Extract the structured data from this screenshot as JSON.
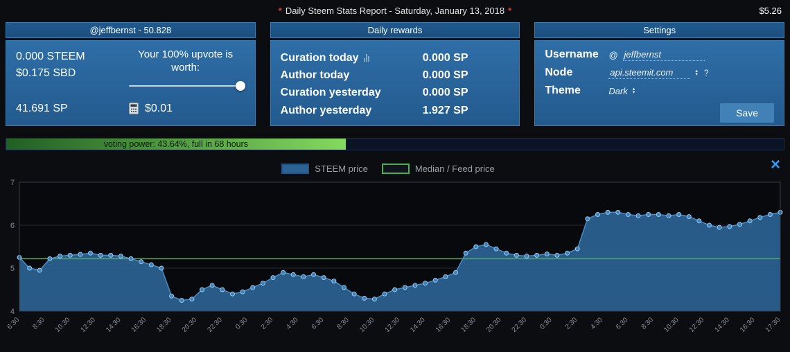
{
  "colors": {
    "accent_red": "#e03b3b",
    "panel_blue": "#2e6ea7",
    "close_blue": "#2f9bf0",
    "voting_green": "#84d95f"
  },
  "topbar": {
    "star": "*",
    "title": "Daily Steem Stats Report - Saturday, January 13, 2018",
    "price": "$5.26"
  },
  "account_panel": {
    "header": "@jeffbernst - 50.828",
    "steem_balance": "0.000 STEEM",
    "sbd_balance": "$0.175 SBD",
    "upvote_label": "Your 100% upvote is worth:",
    "slider_percent": 100,
    "sp_balance": "41.691 SP",
    "upvote_value": "$0.01"
  },
  "rewards_panel": {
    "header": "Daily rewards",
    "rows": [
      {
        "label": "Curation today",
        "value": "0.000 SP"
      },
      {
        "label": "Author today",
        "value": "0.000 SP"
      },
      {
        "label": "Curation yesterday",
        "value": "0.000 SP"
      },
      {
        "label": "Author yesterday",
        "value": "1.927 SP"
      }
    ]
  },
  "settings_panel": {
    "header": "Settings",
    "username_label": "Username",
    "username_prefix": "@",
    "username_value": "jeffbernst",
    "node_label": "Node",
    "node_value": "api.steemit.com",
    "node_help": "?",
    "theme_label": "Theme",
    "theme_value": "Dark",
    "save_label": "Save"
  },
  "voting_power": {
    "label": "voting power: 43.64%, full in 68 hours",
    "percent": 43.64
  },
  "chart_ui": {
    "close_icon": "×"
  },
  "chart_data": {
    "type": "area",
    "title": "",
    "legend_position": "top",
    "grid": true,
    "grid_color": "#26292e",
    "tick_color": "#8a8f96",
    "ylim": [
      4,
      7
    ],
    "yticks": [
      4,
      5,
      6,
      7
    ],
    "x_labels": [
      "6:30",
      "8:30",
      "10:30",
      "12:30",
      "14:30",
      "16:30",
      "18:30",
      "20:30",
      "22:30",
      "0:30",
      "2:30",
      "4:30",
      "6:30",
      "8:30",
      "10:30",
      "12:30",
      "14:30",
      "16:30",
      "18:30",
      "20:30",
      "22:30",
      "0:30",
      "2:30",
      "4:30",
      "6:30",
      "8:30",
      "10:30",
      "12:30",
      "14:30",
      "16:30",
      "17:30"
    ],
    "series": [
      {
        "name": "STEEM price",
        "color_fill": "#2d6394",
        "color_line": "#4a8cc4",
        "color_point": "#3e81b8",
        "color_point_border": "#9cc6e8",
        "values": [
          5.25,
          5.0,
          4.95,
          5.22,
          5.28,
          5.3,
          5.32,
          5.35,
          5.3,
          5.3,
          5.28,
          5.22,
          5.15,
          5.08,
          5.0,
          4.35,
          4.25,
          4.28,
          4.5,
          4.6,
          4.5,
          4.4,
          4.45,
          4.55,
          4.65,
          4.78,
          4.9,
          4.85,
          4.8,
          4.85,
          4.78,
          4.7,
          4.55,
          4.4,
          4.3,
          4.28,
          4.4,
          4.5,
          4.55,
          4.6,
          4.65,
          4.72,
          4.8,
          4.9,
          5.35,
          5.5,
          5.55,
          5.45,
          5.35,
          5.3,
          5.28,
          5.3,
          5.33,
          5.3,
          5.35,
          5.45,
          6.15,
          6.25,
          6.3,
          6.3,
          6.25,
          6.22,
          6.25,
          6.25,
          6.22,
          6.25,
          6.2,
          6.1,
          6.0,
          5.95,
          5.97,
          6.02,
          6.1,
          6.18,
          6.25,
          6.3
        ]
      },
      {
        "name": "Median / Feed price",
        "color_line": "#4caf50",
        "constant_value": 5.22
      }
    ]
  }
}
